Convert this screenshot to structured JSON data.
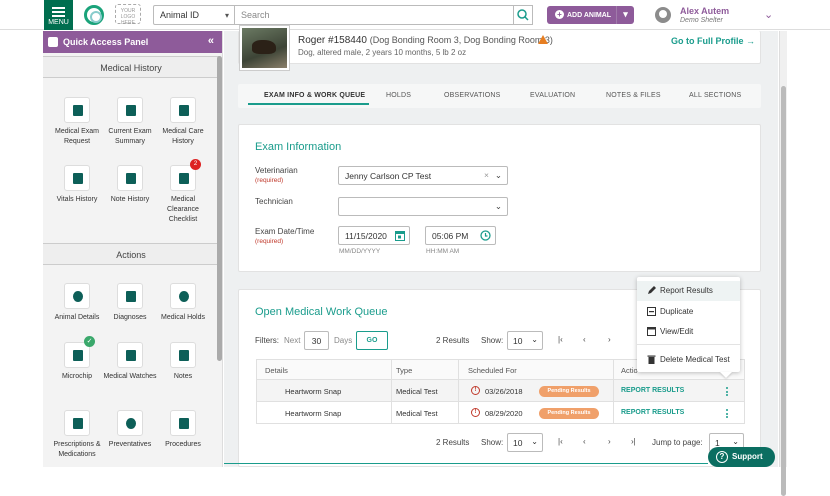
{
  "topbar": {
    "menu_label": "MENU",
    "logo_placeholder": "YOUR LOGO HERE",
    "animal_select": "Animal ID",
    "search_placeholder": "Search",
    "add_animal": "ADD ANIMAL",
    "user_name": "Alex Autem",
    "user_org": "Demo Shelter"
  },
  "sidebar": {
    "title": "Quick Access Panel",
    "medical_history_head": "Medical History",
    "medical_history": [
      {
        "label": "Medical Exam Request",
        "icon": "calendar-icon"
      },
      {
        "label": "Current Exam Summary",
        "icon": "clipboard-icon"
      },
      {
        "label": "Medical Care History",
        "icon": "heart-pulse-icon"
      },
      {
        "label": "Vitals History",
        "icon": "thermometer-icon"
      },
      {
        "label": "Note History",
        "icon": "note-icon"
      },
      {
        "label": "Medical Clearance Checklist",
        "icon": "book-icon",
        "badge": "2"
      }
    ],
    "actions_head": "Actions",
    "actions": [
      {
        "label": "Animal Details",
        "icon": "paw-icon"
      },
      {
        "label": "Diagnoses",
        "icon": "stethoscope-icon"
      },
      {
        "label": "Medical Holds",
        "icon": "alert-icon"
      },
      {
        "label": "Microchip",
        "icon": "microchip-icon",
        "check": "✓"
      },
      {
        "label": "Medical Watches",
        "icon": "watch-icon"
      },
      {
        "label": "Notes",
        "icon": "notes-icon"
      },
      {
        "label": "Prescriptions & Medications",
        "icon": "rx-icon"
      },
      {
        "label": "Preventatives",
        "icon": "pill-icon"
      },
      {
        "label": "Procedures",
        "icon": "heartbeat-icon"
      }
    ]
  },
  "animal": {
    "name": "Roger #158440",
    "location": "(Dog Bonding Room 3, Dog Bonding Room 3)",
    "description": "Dog, altered male, 2 years 10 months, 5 lb 2 oz",
    "full_profile": "Go to Full Profile →"
  },
  "tabs": [
    "EXAM INFO & WORK QUEUE",
    "HOLDS",
    "OBSERVATIONS",
    "EVALUATION",
    "NOTES & FILES",
    "ALL SECTIONS"
  ],
  "exam": {
    "title": "Exam Information",
    "vet_label": "Veterinarian",
    "required": "(required)",
    "vet_value": "Jenny Carlson CP Test",
    "tech_label": "Technician",
    "tech_value": "",
    "date_label": "Exam Date/Time",
    "date_value": "11/15/2020",
    "time_value": "05:06 PM",
    "date_hint": "MM/DD/YYYY",
    "time_hint": "HH:MM AM"
  },
  "queue": {
    "title": "Open Medical Work Queue",
    "filters_label": "Filters:",
    "next_label": "Next",
    "days_value": "30",
    "days_label": "Days",
    "go": "GO",
    "results": "2 Results",
    "show_label": "Show:",
    "show_value": "10",
    "page_value": "1",
    "jump_label": "Jump to page:",
    "columns": [
      "Details",
      "Type",
      "Scheduled For",
      "Actio"
    ],
    "rows": [
      {
        "details": "Heartworm Snap",
        "type": "Medical Test",
        "date": "03/26/2018",
        "status": "Pending Results",
        "action": "REPORT RESULTS"
      },
      {
        "details": "Heartworm Snap",
        "type": "Medical Test",
        "date": "08/29/2020",
        "status": "Pending Results",
        "action": "REPORT RESULTS"
      }
    ]
  },
  "context_menu": [
    "Report Results",
    "Duplicate",
    "View/Edit",
    "Delete Medical Test"
  ],
  "support": "Support"
}
